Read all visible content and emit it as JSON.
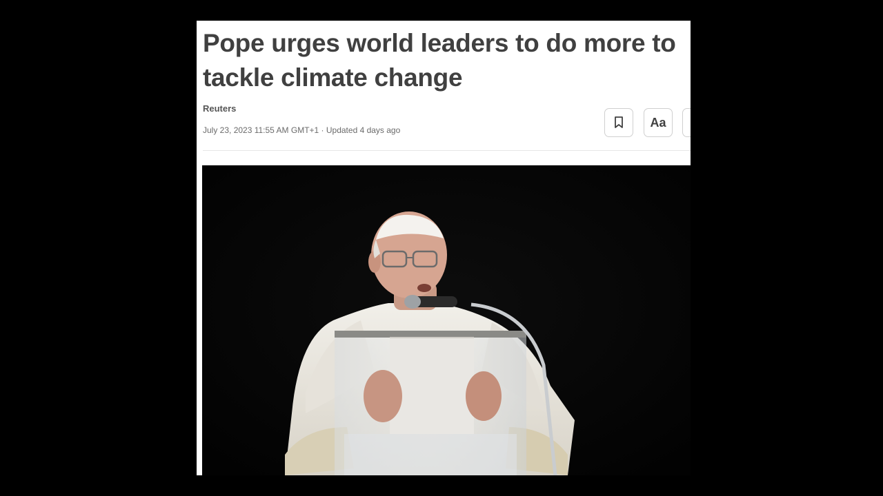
{
  "article": {
    "headline": "Pope urges world leaders to do more to tackle climate change",
    "source": "Reuters",
    "dateline": "July 23, 2023 11:55 AM GMT+1 · Updated 4 days ago"
  },
  "toolbar": {
    "bookmark_icon": "bookmark-icon",
    "text_size_label": "Aa",
    "share_icon": "share-icon"
  },
  "photo": {
    "subject": "pope-speaking-at-lectern"
  }
}
